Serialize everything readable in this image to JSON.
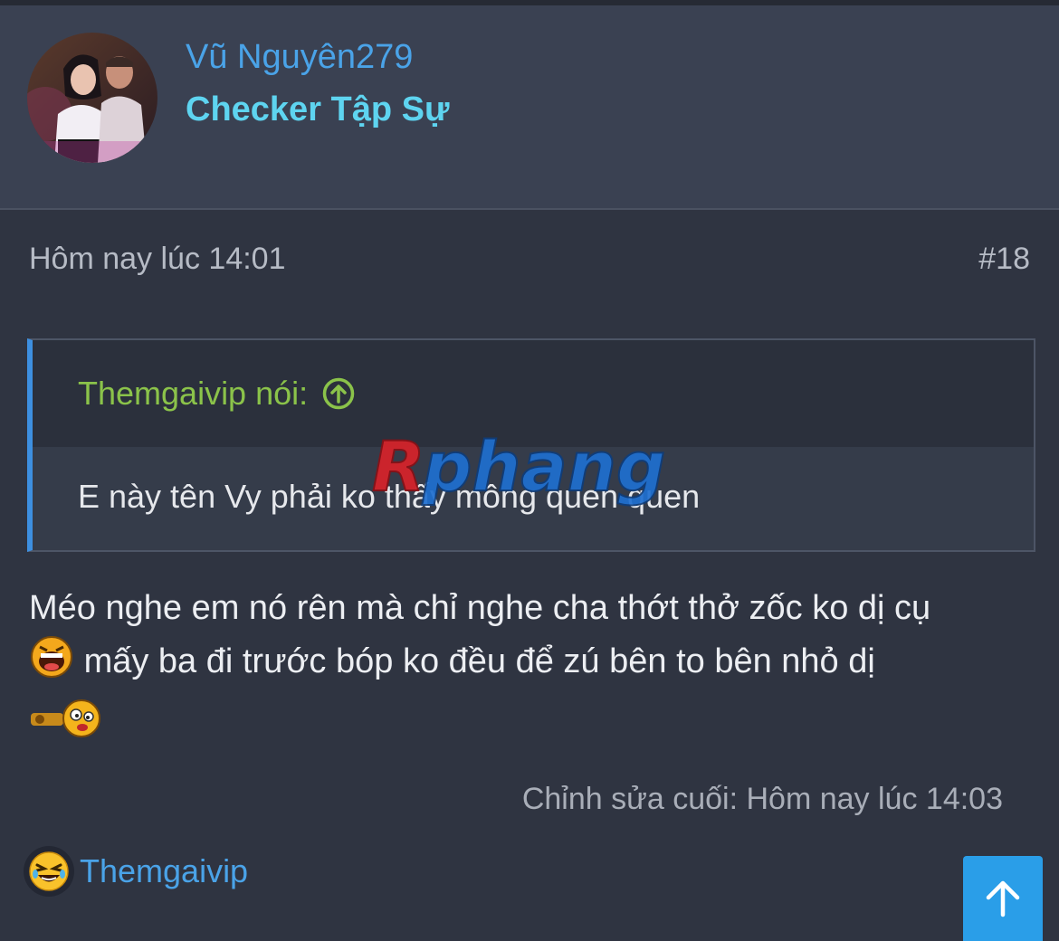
{
  "user": {
    "name": "Vũ Nguyên279",
    "title": "Checker Tập Sự",
    "avatar_icon": "user-avatar-photo"
  },
  "post": {
    "date": "Hôm nay lúc 14:01",
    "number": "#18",
    "quote": {
      "author_label": "Themgaivip nói:",
      "text": "E này tên Vy phải ko thấy mông quen quen"
    },
    "message": {
      "line1": "Méo nghe em nó rên mà chỉ nghe cha thớt thở zốc ko dị cụ",
      "line2": "mấy ba đi trước bóp ko đều để zú bên to bên nhỏ dị"
    },
    "edited": "Chỉnh sửa cuối: Hôm nay lúc 14:03"
  },
  "reaction": {
    "icon": "laughing-emoji-icon",
    "user": "Themgaivip"
  },
  "watermark": {
    "text": "Rphang"
  },
  "colors": {
    "username": "#4aa3e8",
    "user_title": "#5ed4f0",
    "quote_author": "#8bc34a",
    "quote_border": "#3d8fe0",
    "scroll_button": "#2a9ee8"
  }
}
